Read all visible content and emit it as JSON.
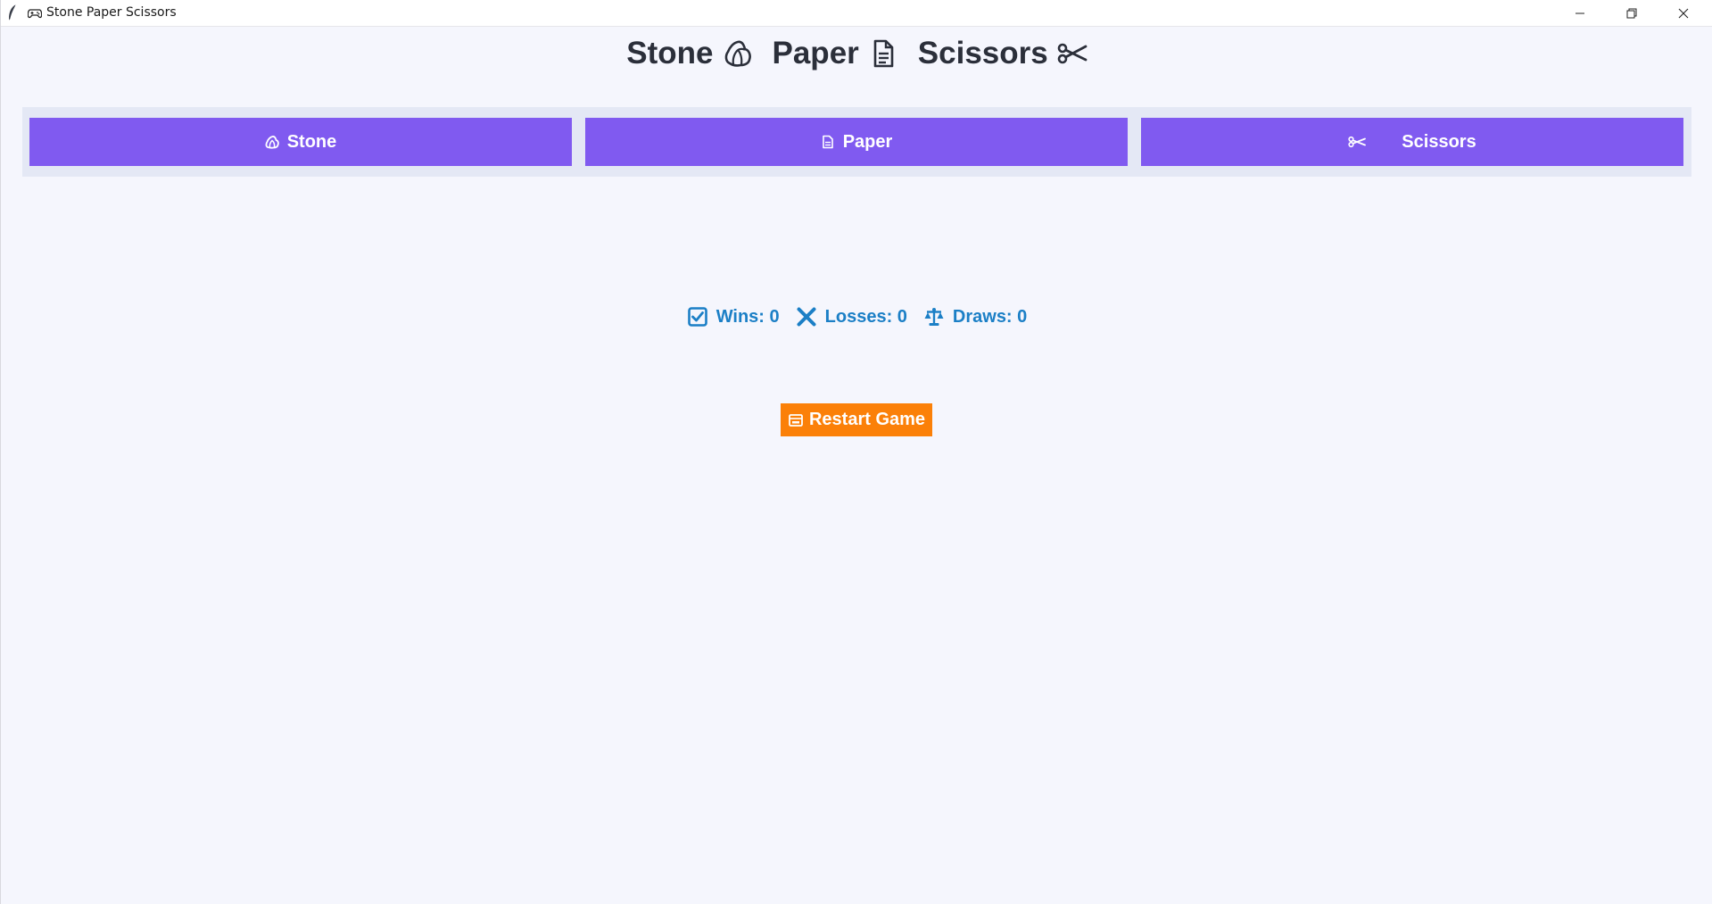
{
  "window": {
    "title": "Stone Paper Scissors",
    "app_icon": "feather-icon",
    "title_icon": "gamepad-icon",
    "controls": [
      "minimize-icon",
      "restore-icon",
      "close-icon"
    ]
  },
  "heading": {
    "stone": "Stone",
    "paper": "Paper",
    "scissors": "Scissors",
    "icons": [
      "rock-icon",
      "page-icon",
      "scissors-icon"
    ]
  },
  "choices": {
    "stone_label": "Stone",
    "paper_label": "Paper",
    "scissors_label": "Scissors"
  },
  "score": {
    "wins": "Wins: 0",
    "losses": "Losses: 0",
    "draws": "Draws: 0"
  },
  "restart": {
    "label": "Restart Game"
  },
  "colors": {
    "background": "#f5f6fd",
    "choice_button": "#805af0",
    "choice_bar": "#e4e8f5",
    "score_text": "#1b7fc6",
    "restart_button": "#fb8008",
    "heading_text": "#2b2f3a"
  }
}
